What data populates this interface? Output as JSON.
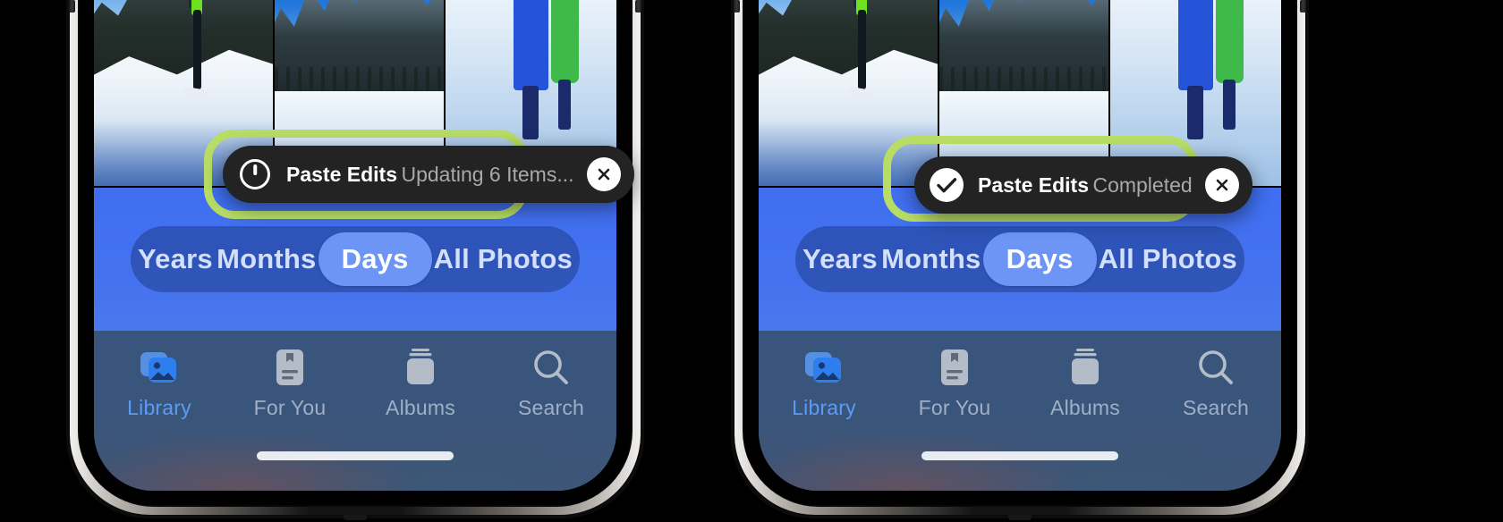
{
  "meta": {
    "background_color": "#000000",
    "accent_color": "#5c9bf5",
    "highlight_color": "#b7dd66",
    "pill_background": "#232323"
  },
  "phones": [
    {
      "id": "left-phone",
      "state": "in-progress",
      "notification": {
        "title": "Paste Edits",
        "subtitle": "Updating 6 Items...",
        "lead_icon": "progress-spinner-icon",
        "close_icon": "close-x-icon",
        "highlighted": true
      },
      "segmented_control": {
        "options": [
          "Years",
          "Months",
          "Days",
          "All Photos"
        ],
        "selected": "Days"
      },
      "tab_bar": {
        "tabs": [
          {
            "label": "Library",
            "icon": "photo-stack-icon",
            "active": true
          },
          {
            "label": "For You",
            "icon": "memories-card-icon",
            "active": false
          },
          {
            "label": "Albums",
            "icon": "albums-stack-icon",
            "active": false
          },
          {
            "label": "Search",
            "icon": "search-icon",
            "active": false
          }
        ]
      },
      "photo_grid": {
        "columns": 3,
        "photos": [
          "skier-on-snowy-ridge",
          "blue-sky-mountain-range",
          "children-in-snow-by-red-fence"
        ]
      },
      "home_indicator": "home-indicator"
    },
    {
      "id": "right-phone",
      "state": "completed",
      "notification": {
        "title": "Paste Edits",
        "subtitle": "Completed",
        "lead_icon": "checkmark-icon",
        "close_icon": "close-x-icon",
        "highlighted": true
      },
      "segmented_control": {
        "options": [
          "Years",
          "Months",
          "Days",
          "All Photos"
        ],
        "selected": "Days"
      },
      "tab_bar": {
        "tabs": [
          {
            "label": "Library",
            "icon": "photo-stack-icon",
            "active": true
          },
          {
            "label": "For You",
            "icon": "memories-card-icon",
            "active": false
          },
          {
            "label": "Albums",
            "icon": "albums-stack-icon",
            "active": false
          },
          {
            "label": "Search",
            "icon": "search-icon",
            "active": false
          }
        ]
      },
      "photo_grid": {
        "columns": 3,
        "photos": [
          "skier-on-snowy-ridge",
          "blue-sky-mountain-range",
          "children-in-snow-by-red-fence"
        ]
      },
      "home_indicator": "home-indicator"
    }
  ]
}
